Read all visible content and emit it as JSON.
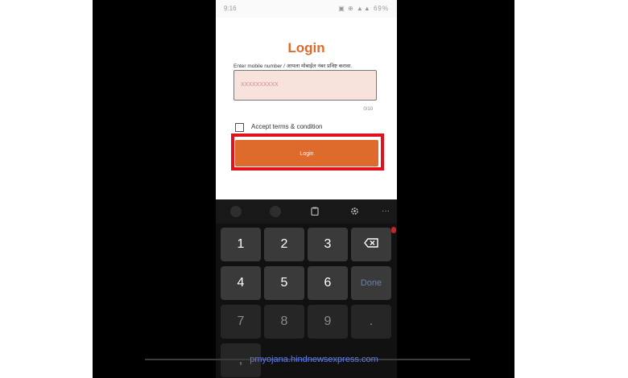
{
  "status_bar": {
    "time": "9:16",
    "icons": "▣ ⊕ ▲▲ 69%"
  },
  "login": {
    "title": "Login",
    "mobile_label": "Enter mobile number / आपला मोबाईल नंबर प्रविष्ट करावा.",
    "mobile_placeholder": "XXXXXXXXXX",
    "mobile_value": "",
    "char_counter": "0/10",
    "terms_label": "Accept terms & condition",
    "terms_checked": false,
    "login_button": "Login"
  },
  "keyboard_toolbar": {
    "icons": [
      "emoji-icon",
      "sticker-icon",
      "clipboard-icon",
      "settings-icon",
      "more-icon"
    ],
    "more_glyph": "···"
  },
  "keypad": {
    "keys": [
      "1",
      "2",
      "3",
      "4",
      "5",
      "6",
      "7",
      "8",
      "9",
      ","
    ],
    "done_label": "Done",
    "period_label": "."
  },
  "colors": {
    "accent": "#de6a2c",
    "highlight": "#e4101b",
    "input_bg": "#f7e3dc",
    "watermark": "#5b7be9"
  },
  "watermark": "pmyojana.hindnewsexpress.com"
}
